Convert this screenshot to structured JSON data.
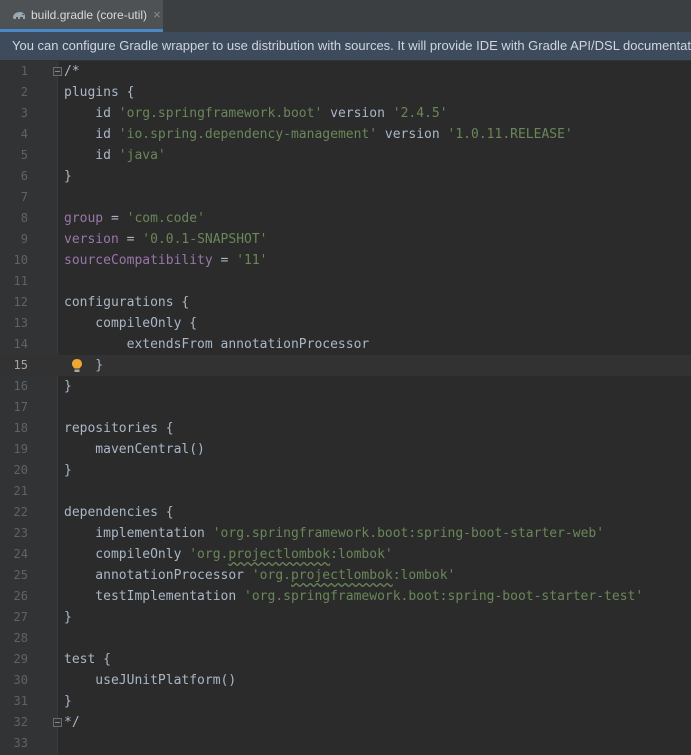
{
  "tab": {
    "title": "build.gradle (core-util)",
    "close_glyph": "×",
    "icon": "gradle-elephant-icon"
  },
  "banner": {
    "text": "You can configure Gradle wrapper to use distribution with sources. It will provide IDE with Gradle API/DSL documentation"
  },
  "editor": {
    "current_line": 15,
    "lines": [
      {
        "n": "1",
        "tokens": [
          {
            "t": "/*",
            "c": "plain"
          }
        ],
        "fold": true
      },
      {
        "n": "2",
        "tokens": [
          {
            "t": "plugins {",
            "c": "plain"
          }
        ]
      },
      {
        "n": "3",
        "tokens": [
          {
            "t": "    id ",
            "c": "plain"
          },
          {
            "t": "'org.springframework.boot'",
            "c": "str"
          },
          {
            "t": " version ",
            "c": "plain"
          },
          {
            "t": "'2.4.5'",
            "c": "str"
          }
        ]
      },
      {
        "n": "4",
        "tokens": [
          {
            "t": "    id ",
            "c": "plain"
          },
          {
            "t": "'io.spring.dependency-management'",
            "c": "str"
          },
          {
            "t": " version ",
            "c": "plain"
          },
          {
            "t": "'1.0.11.RELEASE'",
            "c": "str"
          }
        ]
      },
      {
        "n": "5",
        "tokens": [
          {
            "t": "    id ",
            "c": "plain"
          },
          {
            "t": "'java'",
            "c": "str"
          }
        ]
      },
      {
        "n": "6",
        "tokens": [
          {
            "t": "}",
            "c": "plain"
          }
        ]
      },
      {
        "n": "7",
        "tokens": []
      },
      {
        "n": "8",
        "tokens": [
          {
            "t": "group",
            "c": "prop"
          },
          {
            "t": " = ",
            "c": "plain"
          },
          {
            "t": "'com.code'",
            "c": "str"
          }
        ]
      },
      {
        "n": "9",
        "tokens": [
          {
            "t": "version",
            "c": "prop"
          },
          {
            "t": " = ",
            "c": "plain"
          },
          {
            "t": "'0.0.1-SNAPSHOT'",
            "c": "str"
          }
        ]
      },
      {
        "n": "10",
        "tokens": [
          {
            "t": "sourceCompatibility",
            "c": "prop"
          },
          {
            "t": " = ",
            "c": "plain"
          },
          {
            "t": "'11'",
            "c": "str"
          }
        ]
      },
      {
        "n": "11",
        "tokens": []
      },
      {
        "n": "12",
        "tokens": [
          {
            "t": "configurations {",
            "c": "plain"
          }
        ]
      },
      {
        "n": "13",
        "tokens": [
          {
            "t": "    compileOnly {",
            "c": "plain"
          }
        ]
      },
      {
        "n": "14",
        "tokens": [
          {
            "t": "        extendsFrom annotationProcessor",
            "c": "plain"
          }
        ]
      },
      {
        "n": "15",
        "tokens": [
          {
            "t": "    }",
            "c": "plain"
          }
        ],
        "bulb": true
      },
      {
        "n": "16",
        "tokens": [
          {
            "t": "}",
            "c": "plain"
          }
        ]
      },
      {
        "n": "17",
        "tokens": []
      },
      {
        "n": "18",
        "tokens": [
          {
            "t": "repositories {",
            "c": "plain"
          }
        ]
      },
      {
        "n": "19",
        "tokens": [
          {
            "t": "    mavenCentral()",
            "c": "plain"
          }
        ]
      },
      {
        "n": "20",
        "tokens": [
          {
            "t": "}",
            "c": "plain"
          }
        ]
      },
      {
        "n": "21",
        "tokens": []
      },
      {
        "n": "22",
        "tokens": [
          {
            "t": "dependencies {",
            "c": "plain"
          }
        ]
      },
      {
        "n": "23",
        "tokens": [
          {
            "t": "    implementation ",
            "c": "plain"
          },
          {
            "t": "'org.springframework.boot:spring-boot-starter-web'",
            "c": "str"
          }
        ]
      },
      {
        "n": "24",
        "tokens": [
          {
            "t": "    compileOnly ",
            "c": "plain"
          },
          {
            "t": "'org.",
            "c": "str"
          },
          {
            "t": "projectlombok",
            "c": "str squig"
          },
          {
            "t": ":lombok'",
            "c": "str"
          }
        ]
      },
      {
        "n": "25",
        "tokens": [
          {
            "t": "    annotationProcessor ",
            "c": "plain"
          },
          {
            "t": "'org.",
            "c": "str"
          },
          {
            "t": "projectlombok",
            "c": "str squig"
          },
          {
            "t": ":lombok'",
            "c": "str"
          }
        ]
      },
      {
        "n": "26",
        "tokens": [
          {
            "t": "    testImplementation ",
            "c": "plain"
          },
          {
            "t": "'org.springframework.boot:spring-boot-starter-test'",
            "c": "str"
          }
        ]
      },
      {
        "n": "27",
        "tokens": [
          {
            "t": "}",
            "c": "plain"
          }
        ]
      },
      {
        "n": "28",
        "tokens": []
      },
      {
        "n": "29",
        "tokens": [
          {
            "t": "test {",
            "c": "plain"
          }
        ]
      },
      {
        "n": "30",
        "tokens": [
          {
            "t": "    useJUnitPlatform()",
            "c": "plain"
          }
        ]
      },
      {
        "n": "31",
        "tokens": [
          {
            "t": "}",
            "c": "plain"
          }
        ]
      },
      {
        "n": "32",
        "tokens": [
          {
            "t": "*/",
            "c": "plain"
          }
        ],
        "fold": true
      },
      {
        "n": "33",
        "tokens": []
      }
    ]
  }
}
